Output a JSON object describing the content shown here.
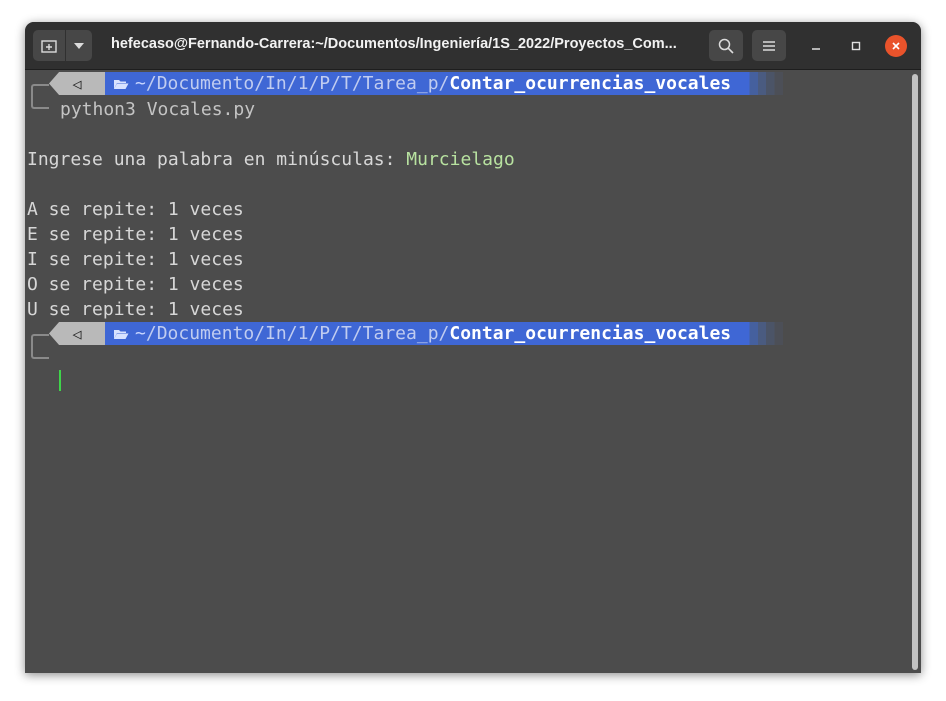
{
  "window": {
    "title": "hefecaso@Fernando-Carrera:~/Documentos/Ingeniería/1S_2022/Proyectos_Com..."
  },
  "icons": {
    "new_tab": "new-tab-icon",
    "dropdown": "chevron-down-icon",
    "search": "search-icon",
    "menu": "hamburger-menu-icon",
    "minimize": "minimize-icon",
    "maximize": "maximize-icon",
    "close": "close-icon",
    "os": "ubuntu-logo-icon",
    "folder": "folder-open-icon"
  },
  "colors": {
    "terminal_bg": "#4c4c4c",
    "prompt_path_bg": "#3f67d5",
    "close_button": "#e9532b",
    "cursor": "#3fd34a"
  },
  "prompt": {
    "home": "~",
    "sep": "/",
    "dirs": [
      "Documento",
      "In",
      "1",
      "P",
      "T",
      "Tarea_p"
    ],
    "current": "Contar_ocurrencias_vocales",
    "os_glyph": "◁"
  },
  "terminal": {
    "command": "python3 Vocales.py",
    "input_prompt": "Ingrese una palabra en minúsculas: ",
    "input_value": "Murcielago",
    "results": [
      "A se repite: 1 veces",
      "E se repite: 1 veces",
      "I se repite: 1 veces",
      "O se repite: 1 veces",
      "U se repite: 1 veces"
    ]
  }
}
